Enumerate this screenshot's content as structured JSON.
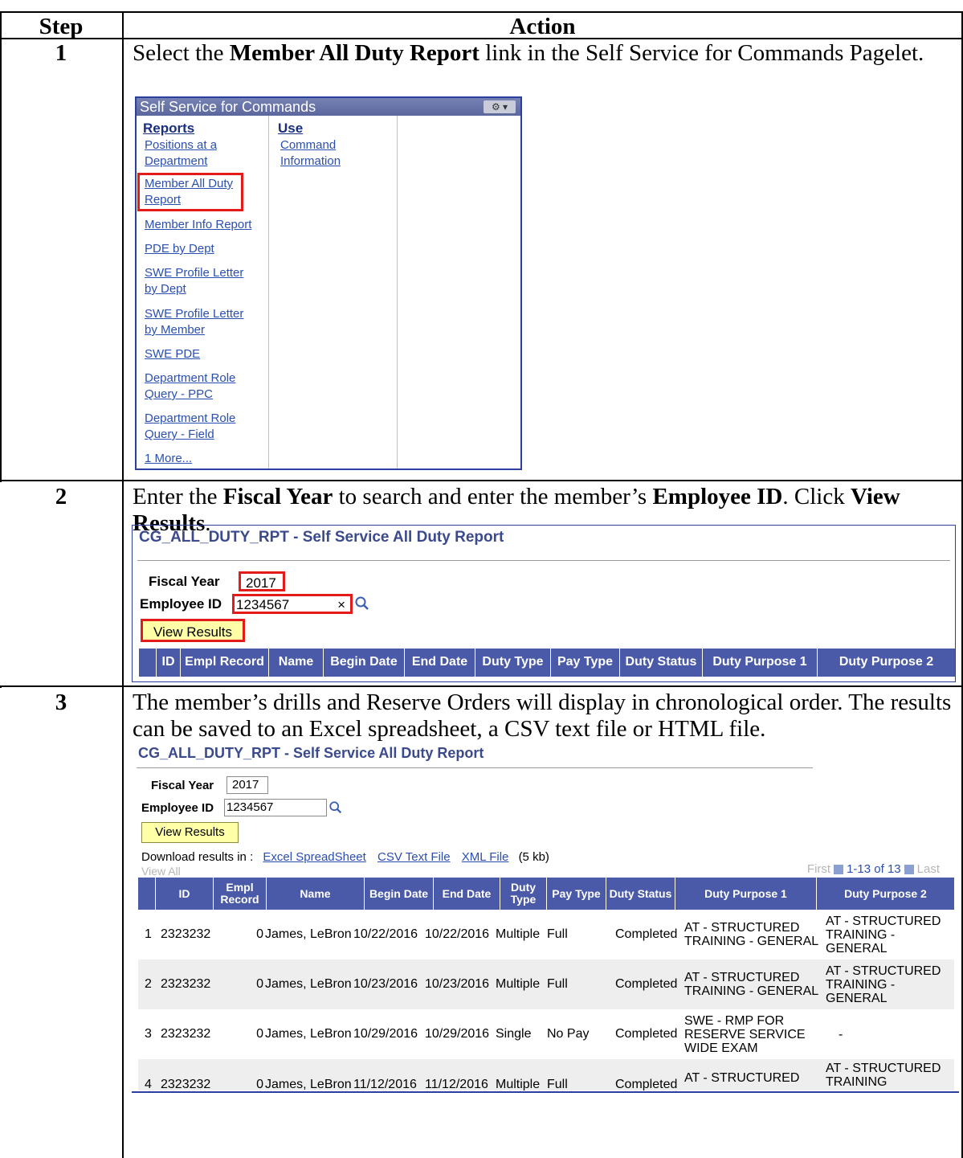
{
  "table": {
    "col_step": "Step",
    "col_action": "Action"
  },
  "steps": [
    {
      "num": "1",
      "text_pre": "Select the ",
      "text_bold": "Member All Duty Report",
      "text_post": " link in the Self Service for Commands Pagelet."
    },
    {
      "num": "2",
      "text_a": "Enter the ",
      "text_b": "Fiscal Year",
      "text_c": " to search and enter the member’s ",
      "text_d": "Employee ID",
      "text_e": ". Click ",
      "text_f": "View Results",
      "text_g": "."
    },
    {
      "num": "3",
      "text": "The member’s drills and Reserve Orders will display in chronological order. The results can be saved to an Excel spreadsheet, a CSV text file or HTML file."
    }
  ],
  "pagelet": {
    "title": "Self Service for Commands",
    "gear": "⚙ ▾",
    "col1_head": "Reports",
    "col2_head": "Use",
    "reports": [
      "Positions at a",
      "Department",
      "Member All Duty",
      "Report",
      "Member Info Report",
      "PDE by Dept",
      "SWE Profile Letter",
      "by Dept",
      "SWE Profile Letter",
      "by Member",
      "SWE PDE",
      "Department Role",
      "Query - PPC",
      "Department Role",
      "Query - Field",
      "1 More..."
    ],
    "use": [
      "Command",
      "Information"
    ]
  },
  "panel2": {
    "title": "CG_ALL_DUTY_RPT - Self Service All Duty Report",
    "fiscal_label": "Fiscal Year",
    "fiscal_value": "2017",
    "emp_label": "Employee ID",
    "emp_value": "1234567",
    "clear": "×",
    "button": "View Results",
    "columns": [
      "ID",
      "Empl Record",
      "Name",
      "Begin Date",
      "End Date",
      "Duty Type",
      "Pay Type",
      "Duty Status",
      "Duty Purpose 1",
      "Duty Purpose 2"
    ]
  },
  "panel3": {
    "title": "CG_ALL_DUTY_RPT - Self Service All Duty Report",
    "fiscal_label": "Fiscal Year",
    "fiscal_value": "2017",
    "emp_label": "Employee ID",
    "emp_value": "1234567",
    "button": "View Results",
    "download_label": "Download results in :",
    "dl_excel": "Excel SpreadSheet",
    "dl_csv": "CSV Text File",
    "dl_xml": "XML File",
    "dl_size": "(5 kb)",
    "view_all": "View All",
    "nav_first": "First",
    "nav_range": "1-13 of 13",
    "nav_last": "Last",
    "columns": [
      "ID",
      "Empl Record",
      "Name",
      "Begin Date",
      "End Date",
      "Duty Type",
      "Pay Type",
      "Duty Status",
      "Duty Purpose 1",
      "Duty Purpose 2"
    ],
    "rows": [
      {
        "n": "1",
        "id": "2323232",
        "rec": "0",
        "name": "James, LeBron",
        "begin": "10/22/2016",
        "end": "10/22/2016",
        "dtype": "Multiple",
        "ptype": "Full",
        "status": "Completed",
        "p1": "AT - STRUCTURED TRAINING - GENERAL",
        "p2": "AT - STRUCTURED TRAINING - GENERAL"
      },
      {
        "n": "2",
        "id": "2323232",
        "rec": "0",
        "name": "James, LeBron",
        "begin": "10/23/2016",
        "end": "10/23/2016",
        "dtype": "Multiple",
        "ptype": "Full",
        "status": "Completed",
        "p1": "AT - STRUCTURED TRAINING - GENERAL",
        "p2": "AT - STRUCTURED TRAINING - GENERAL"
      },
      {
        "n": "3",
        "id": "2323232",
        "rec": "0",
        "name": "James, LeBron",
        "begin": "10/29/2016",
        "end": "10/29/2016",
        "dtype": "Single",
        "ptype": "No Pay",
        "status": "Completed",
        "p1": "SWE - RMP FOR RESERVE SERVICE WIDE EXAM",
        "p2": "-"
      },
      {
        "n": "4",
        "id": "2323232",
        "rec": "0",
        "name": "James, LeBron",
        "begin": "11/12/2016",
        "end": "11/12/2016",
        "dtype": "Multiple",
        "ptype": "Full",
        "status": "Completed",
        "p1": "AT - STRUCTURED",
        "p2": "AT - STRUCTURED TRAINING"
      }
    ]
  },
  "colors": {
    "grid_header": "#4a5aa8",
    "highlight_box": "#e41b1b",
    "button_bg": "#ffffa8",
    "link": "#2a4fb0"
  }
}
